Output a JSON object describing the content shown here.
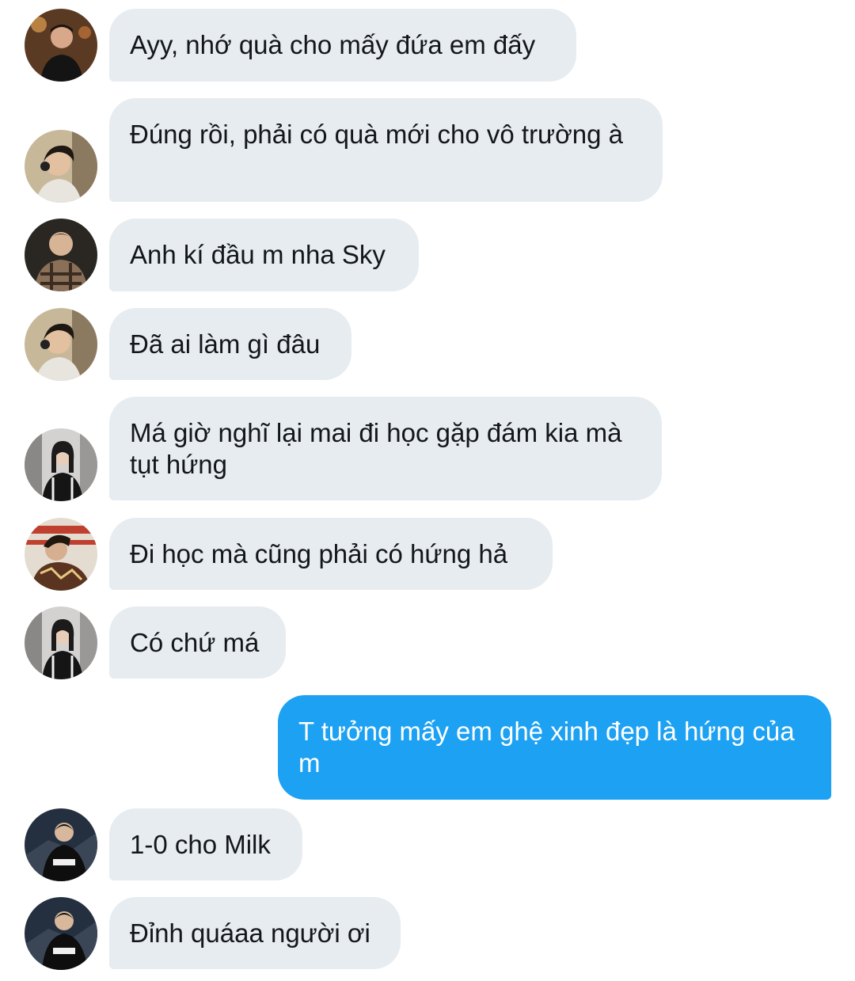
{
  "colors": {
    "incoming_bubble": "#e6ecf0",
    "outgoing_bubble": "#1da1f2",
    "incoming_text": "#14171a",
    "outgoing_text": "#ffffff"
  },
  "messages": [
    {
      "direction": "incoming",
      "avatar": "avatar-user-photo",
      "text": "Ayy, nhớ quà cho mấy đứa em đấy"
    },
    {
      "direction": "incoming",
      "avatar": "avatar-user-photo",
      "text": "Đúng rồi, phải có quà mới cho vô trường à"
    },
    {
      "direction": "incoming",
      "avatar": "avatar-user-photo",
      "text": "Anh kí đầu m nha Sky"
    },
    {
      "direction": "incoming",
      "avatar": "avatar-user-photo",
      "text": "Đã ai làm gì đâu"
    },
    {
      "direction": "incoming",
      "avatar": "avatar-user-photo",
      "text": "Má giờ nghĩ lại mai đi học gặp đám kia mà tụt hứng"
    },
    {
      "direction": "incoming",
      "avatar": "avatar-user-photo",
      "text": "Đi học mà cũng phải có hứng hả"
    },
    {
      "direction": "incoming",
      "avatar": "avatar-user-photo",
      "text": "Có chứ má"
    },
    {
      "direction": "outgoing",
      "text": "T tưởng mấy em ghệ xinh đẹp là hứng của m"
    },
    {
      "direction": "incoming",
      "avatar": "avatar-user-photo",
      "text": "1-0 cho Milk"
    },
    {
      "direction": "incoming",
      "avatar": "avatar-user-photo",
      "text": "Đỉnh quáaa người ơi"
    }
  ]
}
